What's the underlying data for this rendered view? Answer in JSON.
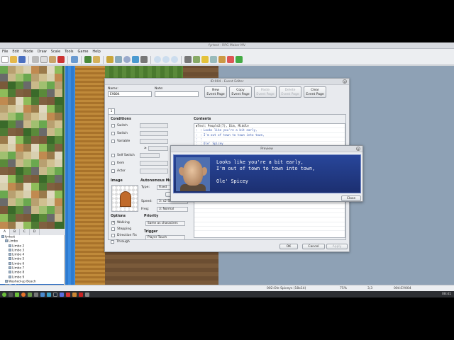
{
  "window": {
    "title": "fyrtest - RPG Maker MV"
  },
  "menu": [
    "File",
    "Edit",
    "Mode",
    "Draw",
    "Scale",
    "Tools",
    "Game",
    "Help"
  ],
  "tileset_tabs": [
    "A",
    "B",
    "C",
    "D"
  ],
  "map_tree": [
    {
      "label": "fyrtest",
      "indent": 0
    },
    {
      "label": "Limbo",
      "indent": 1
    },
    {
      "label": "Limbo 2",
      "indent": 2
    },
    {
      "label": "Limbo 3",
      "indent": 2
    },
    {
      "label": "Limbo 4",
      "indent": 2
    },
    {
      "label": "Limbo 5",
      "indent": 2
    },
    {
      "label": "Limbo 6",
      "indent": 2
    },
    {
      "label": "Limbo 7",
      "indent": 2
    },
    {
      "label": "Limbo 8",
      "indent": 2
    },
    {
      "label": "Limbo 9",
      "indent": 2
    },
    {
      "label": "Washed-up Beach",
      "indent": 1
    },
    {
      "label": "Ole Spicey",
      "indent": 1,
      "selected": true
    },
    {
      "label": "Ole Spiceys Shack",
      "indent": 2
    }
  ],
  "status": {
    "map": "002:Ole Spiceys (18x14)",
    "zoom": "75%",
    "coords": "3,3",
    "event": "004:EV004"
  },
  "clock": "08:41",
  "event_editor": {
    "title": "ID:004 - Event Editor",
    "name_label": "Name:",
    "name_value": "EV004",
    "note_label": "Note:",
    "note_value": "",
    "buttons": {
      "new_page": [
        "New",
        "Event Page"
      ],
      "copy_page": [
        "Copy",
        "Event Page"
      ],
      "paste_page": [
        "Paste",
        "Event Page"
      ],
      "delete_page": [
        "Delete",
        "Event Page"
      ],
      "clear_page": [
        "Clear",
        "Event Page"
      ]
    },
    "page_tab": "1",
    "conditions": {
      "title": "Conditions",
      "switch1": "Switch",
      "switch2": "Switch",
      "variable": "Variable",
      "ge": "≥",
      "self_switch": "Self Switch",
      "item": "Item",
      "actor": "Actor"
    },
    "image_title": "Image",
    "autonomous": {
      "title": "Autonomous Movement",
      "type_label": "Type:",
      "type_value": "Fixed",
      "route_button": "Route...",
      "speed_label": "Speed:",
      "speed_value": "3: x2 Slower",
      "freq_label": "Freq:",
      "freq_value": "3: Normal"
    },
    "options": {
      "title": "Options",
      "walking": "Walking",
      "stepping": "Stepping",
      "direction_fix": "Direction Fix",
      "through": "Through"
    },
    "priority": {
      "title": "Priority",
      "value": "Same as characters"
    },
    "trigger": {
      "title": "Trigger",
      "value": "Player Touch"
    },
    "contents": {
      "title": "Contents",
      "lines": [
        {
          "text": "◆Text：People2(7), Dim, Middle",
          "style": "normal"
        },
        {
          "text": "  ：    ：Looks like you're a bit early,",
          "style": "blue"
        },
        {
          "text": "  ：    ：I'm out of town to town into town,",
          "style": "blue"
        },
        {
          "text": "  ：    ：",
          "style": "blue"
        },
        {
          "text": "  ：    ：Ole' Spicey",
          "style": "blue"
        },
        {
          "text": "◆",
          "style": "normal"
        }
      ]
    },
    "footer": {
      "ok": "OK",
      "cancel": "Cancel",
      "apply": "Apply"
    }
  },
  "preview": {
    "title": "Preview",
    "lines": [
      "Looks like you're a bit early,",
      "I'm out of town to town into town,",
      "",
      "Ole' Spicey"
    ],
    "close": "Close"
  },
  "colors": {
    "message_window": "#28469a",
    "selection": "#2f6fc4"
  }
}
